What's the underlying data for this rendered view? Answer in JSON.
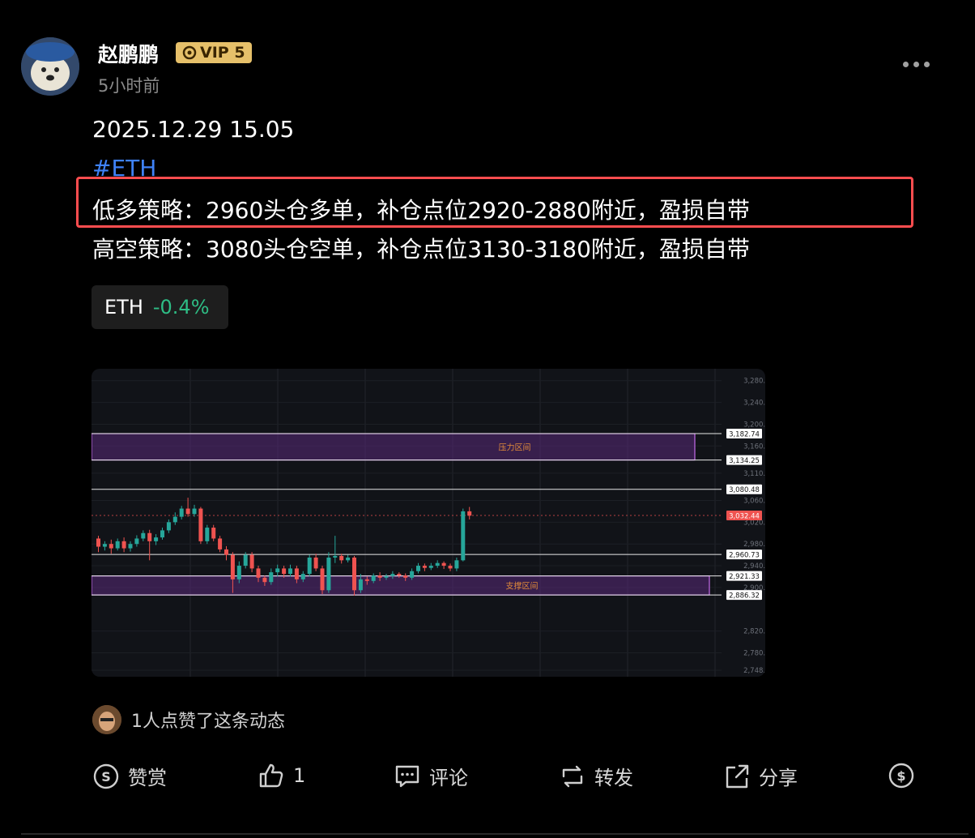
{
  "post": {
    "author": "赵鹏鹏",
    "vip_label": "VIP 5",
    "time": "5小时前",
    "date_line": "2025.12.29 15.05",
    "hashtag": "#ETH",
    "strategy_long": "低多策略：2960头仓多单，补仓点位2920-2880附近，盈损自带",
    "strategy_short": "高空策略：3080头仓空单，补仓点位3130-3180附近，盈损自带"
  },
  "ticker": {
    "symbol": "ETH",
    "change": "-0.4%",
    "change_color": "#2ebd85"
  },
  "chart_data": {
    "type": "candlestick",
    "ylim": [
      2748,
      3290
    ],
    "y_ticks": [
      "3,280.00",
      "3,240.00",
      "3,200.00",
      "3,160.00",
      "3,110.00",
      "3,060.00",
      "3,020.00",
      "2,980.00",
      "2,940.00",
      "2,900.00",
      "2,820.00",
      "2,780.00",
      "2,748.00"
    ],
    "y_tick_values": [
      3280,
      3240,
      3200,
      3160,
      3110,
      3060,
      3020,
      2980,
      2940,
      2900,
      2820,
      2780,
      2748
    ],
    "levels": [
      {
        "label": "3,182.74",
        "value": 3182.74
      },
      {
        "label": "3,134.25",
        "value": 3134.25
      },
      {
        "label": "3,080.48",
        "value": 3080.48
      },
      {
        "label": "2,960.73",
        "value": 2960.73
      },
      {
        "label": "2,921.33",
        "value": 2921.33
      },
      {
        "label": "2,886.32",
        "value": 2886.32
      }
    ],
    "current_price": {
      "label": "3,032.44",
      "value": 3032.44
    },
    "zones": [
      {
        "name": "压力区间",
        "low": 3134.25,
        "high": 3182.74
      },
      {
        "name": "支撑区间",
        "low": 2886.32,
        "high": 2921.33
      }
    ],
    "candles": [
      [
        2990,
        2975,
        2995,
        2965
      ],
      [
        2975,
        2980,
        2985,
        2968
      ],
      [
        2980,
        2972,
        2988,
        2962
      ],
      [
        2972,
        2985,
        2990,
        2968
      ],
      [
        2985,
        2972,
        2992,
        2965
      ],
      [
        2972,
        2980,
        2985,
        2966
      ],
      [
        2980,
        2990,
        2996,
        2975
      ],
      [
        2990,
        3000,
        3005,
        2985
      ],
      [
        3000,
        2985,
        3006,
        2950
      ],
      [
        2985,
        2992,
        2998,
        2978
      ],
      [
        2992,
        3005,
        3010,
        2988
      ],
      [
        3005,
        3020,
        3025,
        3000
      ],
      [
        3020,
        3030,
        3038,
        3015
      ],
      [
        3030,
        3045,
        3050,
        3025
      ],
      [
        3045,
        3035,
        3065,
        3030
      ],
      [
        3035,
        3045,
        3052,
        3030
      ],
      [
        3045,
        2985,
        3048,
        2980
      ],
      [
        2985,
        3010,
        3015,
        2980
      ],
      [
        3010,
        2990,
        3015,
        2985
      ],
      [
        2990,
        2970,
        2995,
        2965
      ],
      [
        2970,
        2960,
        2976,
        2950
      ],
      [
        2960,
        2915,
        2965,
        2890
      ],
      [
        2915,
        2940,
        2948,
        2908
      ],
      [
        2940,
        2960,
        2965,
        2935
      ],
      [
        2960,
        2935,
        2965,
        2928
      ],
      [
        2935,
        2918,
        2940,
        2910
      ],
      [
        2918,
        2910,
        2922,
        2903
      ],
      [
        2910,
        2928,
        2935,
        2905
      ],
      [
        2928,
        2935,
        2942,
        2920
      ],
      [
        2935,
        2925,
        2940,
        2918
      ],
      [
        2925,
        2935,
        2942,
        2920
      ],
      [
        2935,
        2915,
        2940,
        2908
      ],
      [
        2915,
        2925,
        2930,
        2910
      ],
      [
        2925,
        2955,
        2960,
        2920
      ],
      [
        2955,
        2935,
        2962,
        2930
      ],
      [
        2935,
        2895,
        2940,
        2888
      ],
      [
        2895,
        2955,
        2965,
        2890
      ],
      [
        2955,
        2958,
        2995,
        2945
      ],
      [
        2958,
        2950,
        2962,
        2944
      ],
      [
        2950,
        2955,
        2960,
        2946
      ],
      [
        2955,
        2895,
        2958,
        2885
      ],
      [
        2895,
        2915,
        2925,
        2890
      ],
      [
        2915,
        2912,
        2920,
        2905
      ],
      [
        2912,
        2922,
        2926,
        2908
      ],
      [
        2922,
        2918,
        2928,
        2912
      ],
      [
        2918,
        2921,
        2925,
        2914
      ],
      [
        2921,
        2925,
        2930,
        2916
      ],
      [
        2925,
        2922,
        2928,
        2918
      ],
      [
        2922,
        2918,
        2926,
        2912
      ],
      [
        2918,
        2930,
        2935,
        2914
      ],
      [
        2930,
        2940,
        2945,
        2926
      ],
      [
        2940,
        2936,
        2944,
        2930
      ],
      [
        2936,
        2940,
        2945,
        2932
      ],
      [
        2940,
        2945,
        2950,
        2936
      ],
      [
        2945,
        2940,
        2948,
        2934
      ],
      [
        2940,
        2935,
        2944,
        2930
      ],
      [
        2935,
        2950,
        2955,
        2930
      ],
      [
        2950,
        3040,
        3045,
        2948
      ],
      [
        3040,
        3032,
        3048,
        3025
      ]
    ],
    "up_color": "#26a69a",
    "down_color": "#ef5350"
  },
  "likes": {
    "text": "1人点赞了这条动态"
  },
  "actions": {
    "reward": "赞赏",
    "like_count": "1",
    "comment": "评论",
    "repost": "转发",
    "share": "分享"
  }
}
